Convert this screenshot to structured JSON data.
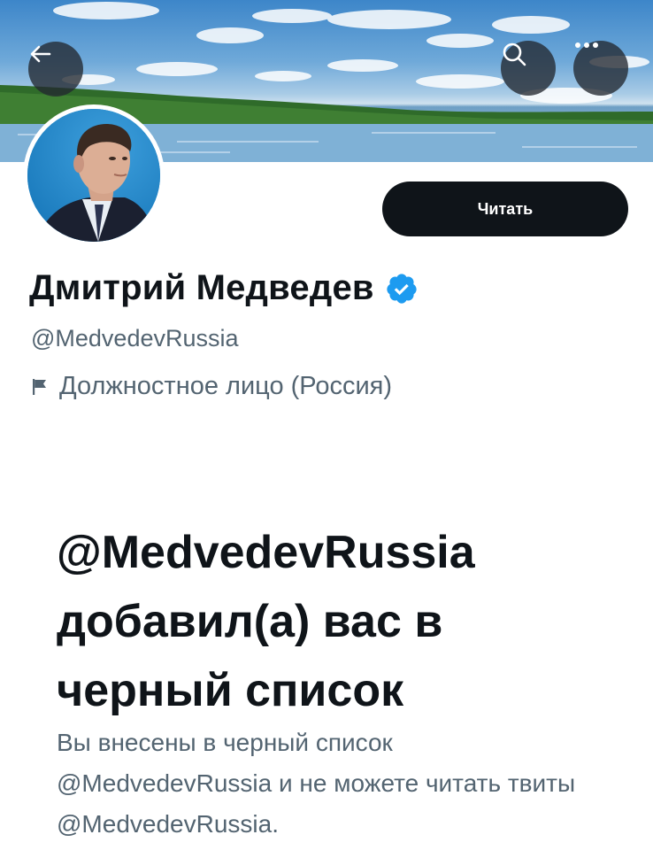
{
  "header": {
    "back_icon": "arrow-left-icon",
    "search_icon": "search-icon",
    "more_icon": "more-horizontal-icon"
  },
  "profile": {
    "display_name": "Дмитрий Медведев",
    "verified": true,
    "handle": "@MedvedevRussia",
    "category": "Должностное лицо (Россия)",
    "category_icon": "flag-icon"
  },
  "actions": {
    "follow_label": "Читать"
  },
  "blocked": {
    "title": "@MedvedevRussia добавил(а) вас в черный список",
    "description": "Вы внесены в черный список @MedvedevRussia и не можете читать твиты @MedvedevRussia."
  },
  "colors": {
    "verified_blue": "#1d9bf0",
    "button_dark": "#0f1419",
    "secondary_text": "#536471"
  }
}
